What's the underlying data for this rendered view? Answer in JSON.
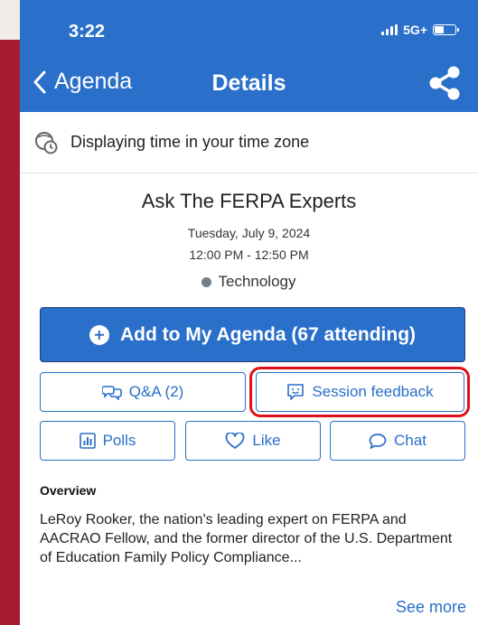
{
  "status_bar": {
    "time": "3:22",
    "network": "5G+"
  },
  "nav": {
    "back_label": "Agenda",
    "title": "Details"
  },
  "timezone_notice": "Displaying time in your time zone",
  "session": {
    "title": "Ask The FERPA Experts",
    "date": "Tuesday, July 9, 2024",
    "time": "12:00 PM - 12:50 PM",
    "track": "Technology",
    "track_color": "#6c7f8a"
  },
  "actions": {
    "add_agenda": "Add to My Agenda (67 attending)",
    "qa": "Q&A (2)",
    "feedback": "Session feedback",
    "polls": "Polls",
    "like": "Like",
    "chat": "Chat"
  },
  "overview": {
    "heading": "Overview",
    "text": "LeRoy Rooker, the nation's leading expert on FERPA and AACRAO Fellow, and the former director of the U.S. Department of Education Family Policy Compliance...",
    "see_more": "See more"
  },
  "colors": {
    "primary": "#2a6fc9",
    "highlight": "#e0101b",
    "side_brand": "#a51c30"
  },
  "icons": {
    "back": "chevron-left-icon",
    "share": "share-icon",
    "clock": "clock-icon",
    "plus": "plus-circle-icon",
    "qa": "chat-bubbles-icon",
    "feedback": "feedback-icon",
    "polls": "bar-chart-icon",
    "like": "heart-icon",
    "chat": "chat-bubble-icon"
  }
}
